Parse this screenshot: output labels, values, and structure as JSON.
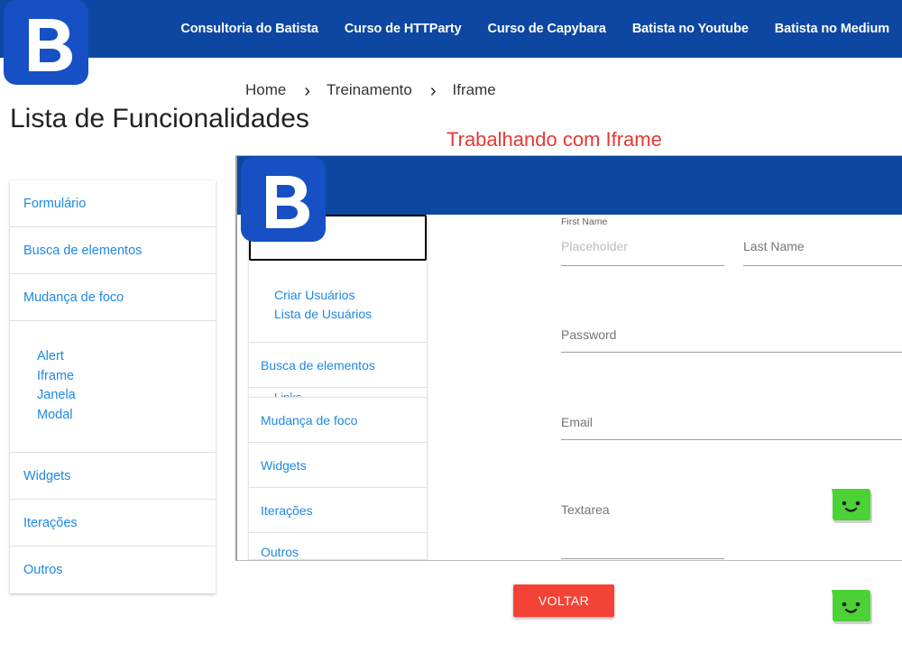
{
  "nav": {
    "links": [
      "Consultoria do Batista",
      "Curso de HTTParty",
      "Curso de Capybara",
      "Batista no Youtube",
      "Batista no Medium"
    ],
    "brand_color": "#0d47a1"
  },
  "logo": {
    "letter": "B",
    "color": "#1750c4"
  },
  "breadcrumb": {
    "items": [
      "Home",
      "Treinamento",
      "Iframe"
    ],
    "separator": "›"
  },
  "sidebar": {
    "title": "Lista de Funcionalidades",
    "items": [
      "Formulário",
      "Busca de elementos",
      "Mudança de foco"
    ],
    "subitems": [
      "Alert",
      "Iframe",
      "Janela",
      "Modal"
    ],
    "items_after": [
      "Widgets",
      "Iterações",
      "Outros"
    ],
    "link_color": "#1e88e5"
  },
  "page": {
    "heading": "Trabalhando com Iframe",
    "heading_color": "#e53935"
  },
  "iframe": {
    "menu": {
      "subitems": [
        "Criar Usuários",
        "Lista de Usuários"
      ],
      "item1": "Busca de elementos",
      "partial": "Links",
      "items": [
        "Mudança de foco",
        "Widgets",
        "Iterações"
      ],
      "last_cut": "Outros"
    },
    "form": {
      "first_name_label": "First Name",
      "first_name_placeholder": "Placeholder",
      "last_name_label": "Last Name",
      "password_label": "Password",
      "email_label": "Email",
      "textarea_label": "Textarea"
    }
  },
  "actions": {
    "voltar_label": "VOLTAR",
    "button_color": "#f44336"
  },
  "chat": {
    "icon": "chat-bot-icon",
    "color": "#4cd137"
  }
}
